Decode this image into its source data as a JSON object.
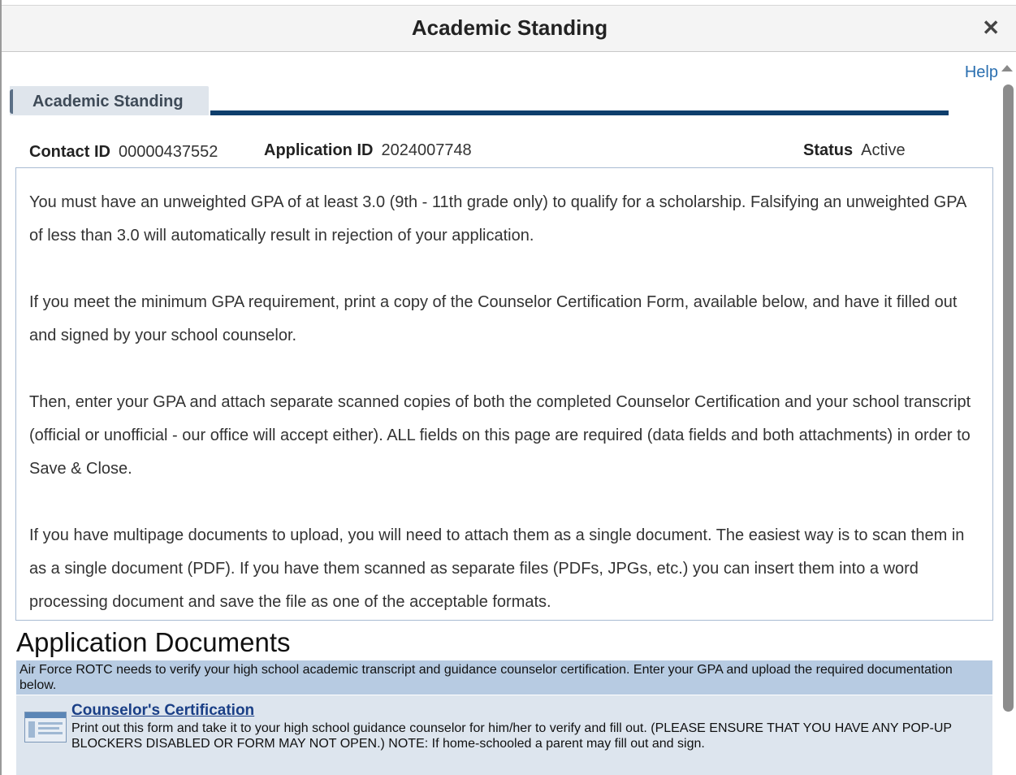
{
  "window": {
    "title": "Academic Standing",
    "close_label": "✕"
  },
  "help_label": "Help",
  "tab": {
    "label": "Academic Standing"
  },
  "info": {
    "contact_id_label": "Contact ID",
    "contact_id_value": "00000437552",
    "application_id_label": "Application ID",
    "application_id_value": "2024007748",
    "status_label": "Status",
    "status_value": "Active"
  },
  "instructions": [
    "You must have an unweighted GPA of at least 3.0 (9th - 11th grade only) to qualify for a scholarship.  Falsifying an unweighted GPA of less than 3.0 will automatically result in rejection of your application.",
    "If you meet the minimum GPA requirement, print a copy of the Counselor Certification Form, available below, and have it filled out and signed by your school counselor.",
    "Then, enter your GPA and attach separate scanned copies of both the completed Counselor Certification and your school transcript (official or unofficial - our office will accept either).  ALL fields on this page are required (data fields and both attachments) in order to Save & Close.",
    "If you have multipage documents to upload, you will need to attach them as a single document.  The easiest way is to scan them in as a single document (PDF).  If you have them scanned as separate files (PDFs, JPGs, etc.) you can insert them into a word processing document and save the file as one of the acceptable formats."
  ],
  "documents": {
    "heading": "Application Documents",
    "note": "Air Force ROTC needs to verify your high school academic transcript and guidance counselor certification. Enter your GPA and upload the required documentation below.",
    "items": [
      {
        "link": "Counselor's Certification",
        "description": "Print out this form and take it to your high school guidance counselor for him/her to verify and fill out. (PLEASE ENSURE THAT YOU HAVE ANY POP-UP BLOCKERS DISABLED OR FORM MAY NOT OPEN.) NOTE: If home-schooled a parent may fill out and sign."
      }
    ]
  },
  "colors": {
    "accent": "#0e3e6c",
    "link": "#1a3f86",
    "note_bg": "#b7cbe2",
    "item_bg": "#dde5ee"
  }
}
